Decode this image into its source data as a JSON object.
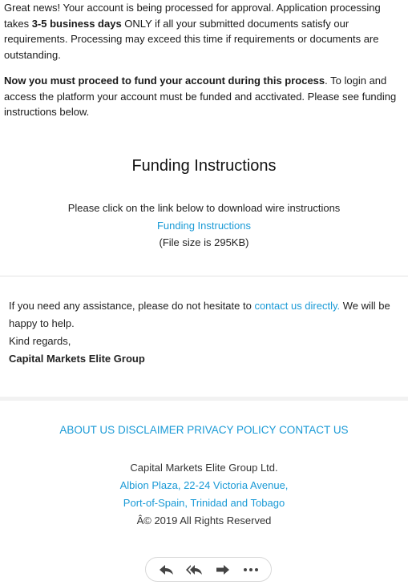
{
  "intro": {
    "p1_a": "Great news! Your account is being processed for approval. Application processing takes ",
    "p1_bold": "3-5 business days",
    "p1_b": " ONLY if all your submitted documents satisfy our requirements. Processing may exceed this time if requirements or documents are outstanding.",
    "p2_bold": "Now you must proceed to fund your account during this process",
    "p2_rest": ". To login and access the platform your account must be funded and acctivated. Please see funding instructions below."
  },
  "funding": {
    "title": "Funding Instructions",
    "instruction": "Please click on the link below to download wire instructions",
    "link_label": "Funding Instructions",
    "file_size": "(File size is 295KB)"
  },
  "assist": {
    "text_a": "If you need any assistance, please do not hesitate to ",
    "link": "contact us directly.",
    "text_b": " We will be happy to help.",
    "regards": "Kind regards,",
    "company": "Capital Markets Elite Group"
  },
  "footer": {
    "nav": [
      "ABOUT US",
      "DISCLAIMER",
      "PRIVACY POLICY",
      "CONTACT US"
    ],
    "company": "Capital Markets Elite Group Ltd.",
    "address1": "Albion Plaza, 22-24 Victoria Avenue,",
    "address2": "Port-of-Spain, Trinidad and Tobago",
    "copyright": "Â© 2019 All Rights Reserved"
  },
  "toolbar": {
    "icons": [
      "reply-icon",
      "reply-all-icon",
      "forward-icon",
      "more-icon"
    ]
  },
  "colors": {
    "link": "#1a9ad6",
    "divider": "#e3e3e3"
  }
}
